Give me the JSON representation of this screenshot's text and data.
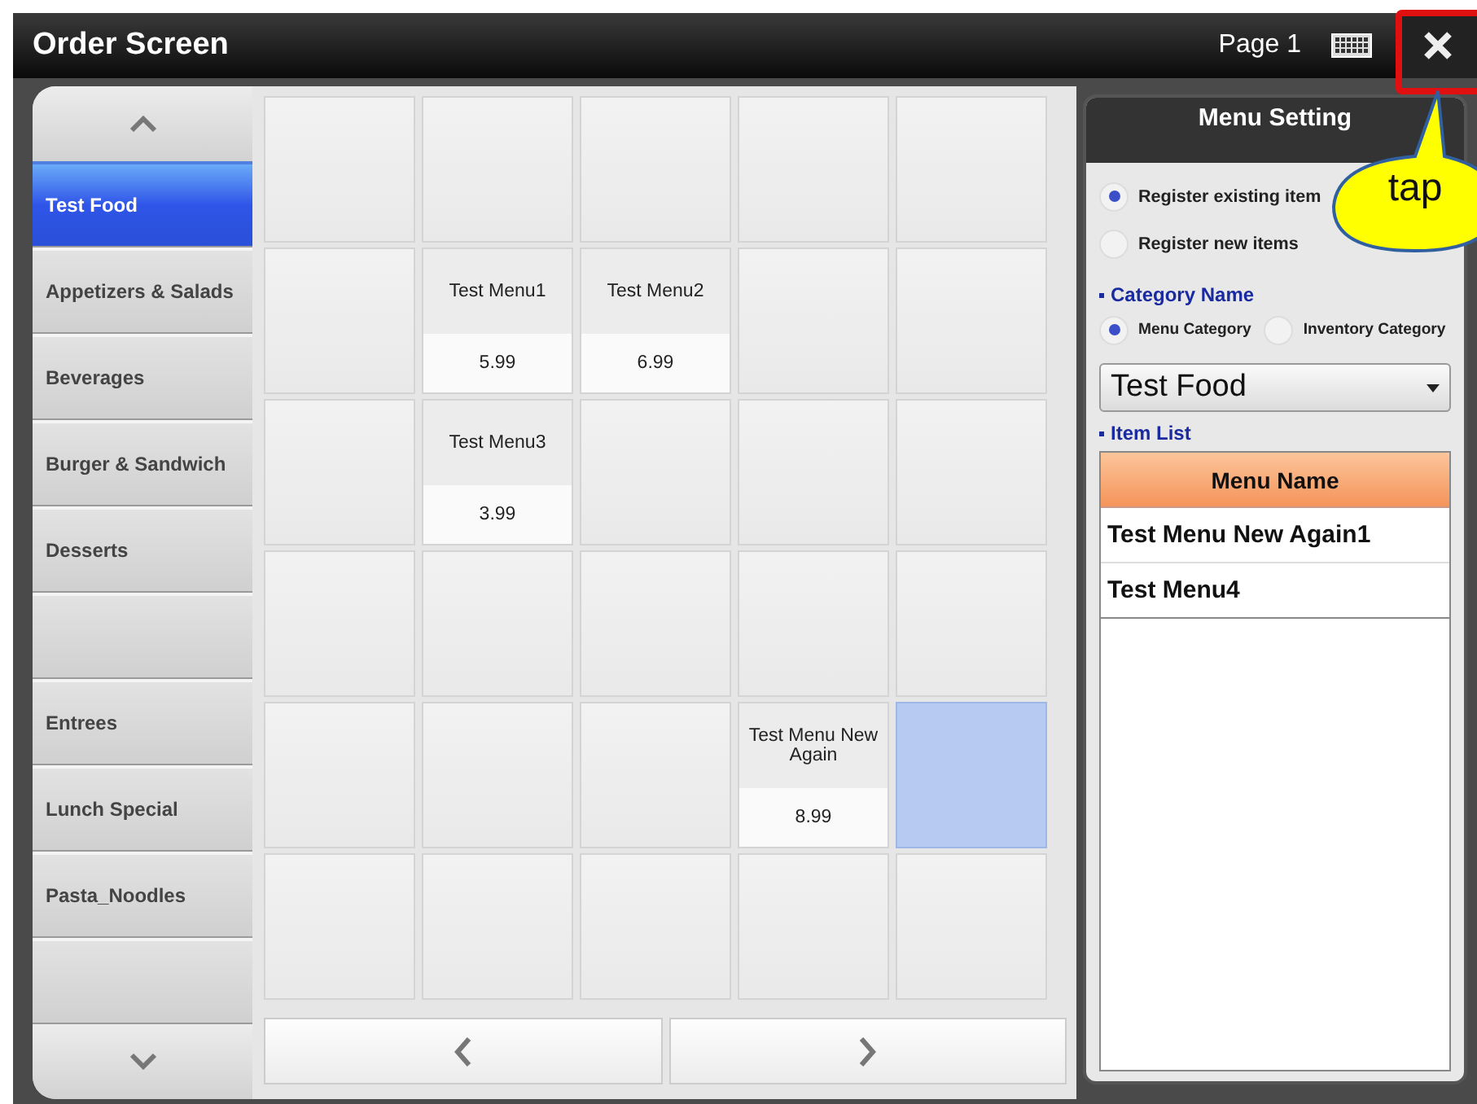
{
  "window": {
    "title": "Order Screen",
    "page": "Page 1"
  },
  "categories": [
    {
      "label": "Test Food",
      "selected": true
    },
    {
      "label": "Appetizers & Salads",
      "selected": false
    },
    {
      "label": "Beverages",
      "selected": false
    },
    {
      "label": "Burger & Sandwich",
      "selected": false
    },
    {
      "label": "Desserts",
      "selected": false
    },
    {
      "selected": false
    },
    {
      "label": "Entrees",
      "selected": false
    },
    {
      "label": "Lunch Special",
      "selected": false
    },
    {
      "label": "Pasta_Noodles",
      "selected": false
    },
    {
      "selected": false
    }
  ],
  "grid": [
    {
      "kind": "empty",
      "selected": false
    },
    {
      "kind": "empty",
      "selected": false
    },
    {
      "kind": "empty",
      "selected": false
    },
    {
      "kind": "empty",
      "selected": false
    },
    {
      "kind": "empty",
      "selected": false
    },
    {
      "kind": "empty",
      "selected": false
    },
    {
      "kind": "item",
      "name": "Test Menu1",
      "price": "5.99",
      "selected": false
    },
    {
      "kind": "item",
      "name": "Test Menu2",
      "price": "6.99",
      "selected": false
    },
    {
      "kind": "empty",
      "selected": false
    },
    {
      "kind": "empty",
      "selected": false
    },
    {
      "kind": "empty",
      "selected": false
    },
    {
      "kind": "item",
      "name": "Test Menu3",
      "price": "3.99",
      "selected": false
    },
    {
      "kind": "empty",
      "selected": false
    },
    {
      "kind": "empty",
      "selected": false
    },
    {
      "kind": "empty",
      "selected": false
    },
    {
      "kind": "empty",
      "selected": false
    },
    {
      "kind": "empty",
      "selected": false
    },
    {
      "kind": "empty",
      "selected": false
    },
    {
      "kind": "empty",
      "selected": false
    },
    {
      "kind": "empty",
      "selected": false
    },
    {
      "kind": "empty",
      "selected": false
    },
    {
      "kind": "empty",
      "selected": false
    },
    {
      "kind": "empty",
      "selected": false
    },
    {
      "kind": "item",
      "name": "Test Menu New Again",
      "price": "8.99",
      "selected": false
    },
    {
      "kind": "empty",
      "selected": true
    },
    {
      "kind": "empty",
      "selected": false
    },
    {
      "kind": "empty",
      "selected": false
    },
    {
      "kind": "empty",
      "selected": false
    },
    {
      "kind": "empty",
      "selected": false
    },
    {
      "kind": "empty",
      "selected": false
    }
  ],
  "menu_setting": {
    "title": "Menu Setting",
    "register_options": [
      {
        "label": "Register existing item",
        "selected": true
      },
      {
        "label": "Register new items",
        "selected": false
      }
    ],
    "category_name_label": "Category Name",
    "category_types": [
      {
        "label": "Menu Category",
        "selected": true
      },
      {
        "label": "Inventory Category",
        "selected": false
      }
    ],
    "category_dropdown": {
      "value": "Test Food"
    },
    "item_list_label": "Item List",
    "item_list": {
      "column": "Menu Name",
      "rows": [
        "Test Menu New Again1",
        "Test Menu4"
      ]
    }
  },
  "callout": {
    "text": "tap"
  }
}
